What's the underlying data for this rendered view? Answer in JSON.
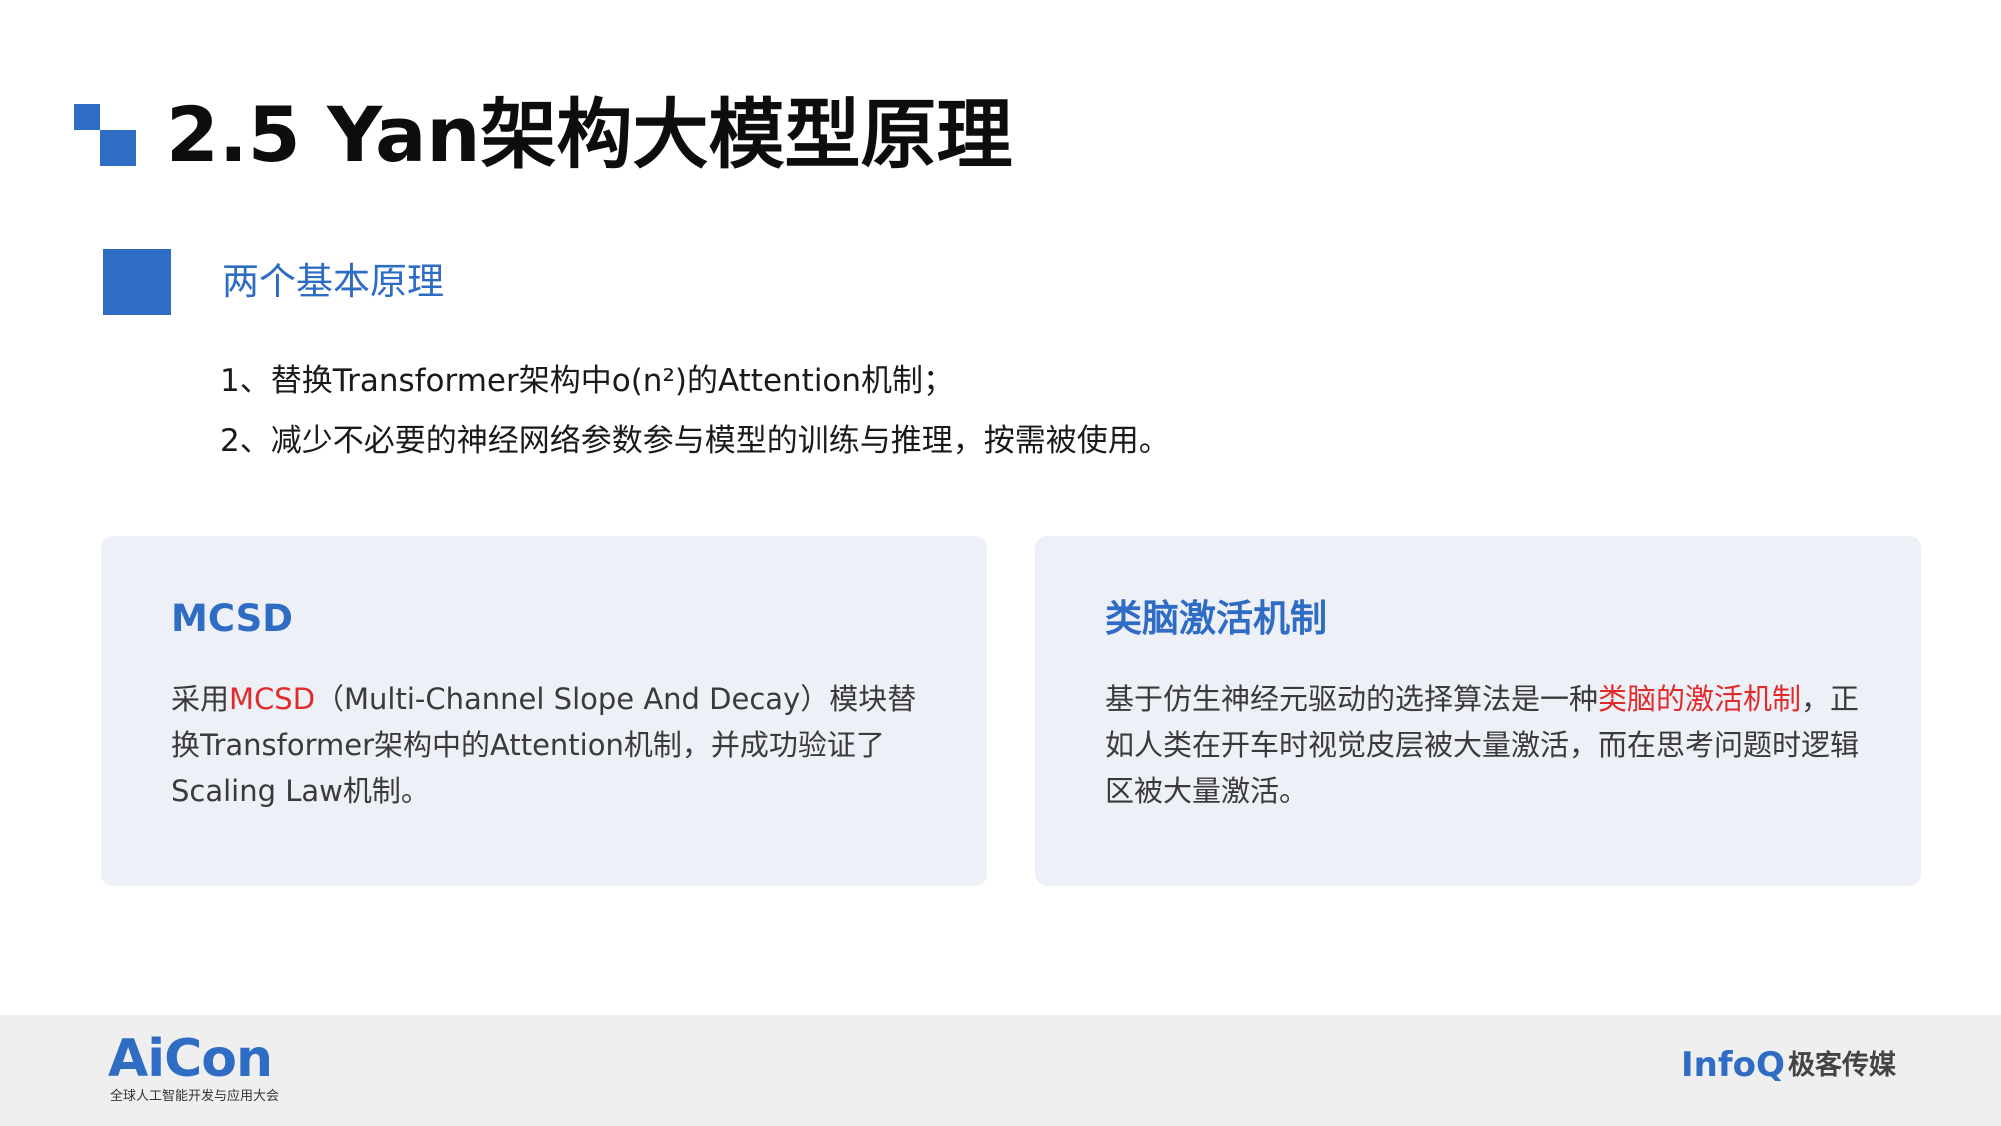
{
  "header": {
    "title": "2.5 Yan架构大模型原理"
  },
  "section": {
    "title": "两个基本原理",
    "principles": [
      "1、替换Transformer架构中o(n²)的Attention机制；",
      "2、减少不必要的神经网络参数参与模型的训练与推理，按需被使用。"
    ]
  },
  "cards": [
    {
      "title": "MCSD",
      "body_before": "采用",
      "body_highlight": "MCSD",
      "body_after": "（Multi-Channel Slope And Decay）模块替换Transformer架构中的Attention机制，并成功验证了Scaling Law机制。"
    },
    {
      "title": "类脑激活机制",
      "body_before": "基于仿生神经元驱动的选择算法是一种",
      "body_highlight": "类脑的激活机制",
      "body_after": "，正如人类在开车时视觉皮层被大量激活，而在思考问题时逻辑区被大量激活。"
    }
  ],
  "footer": {
    "left_logo": "AiCon",
    "left_subtitle": "全球人工智能开发与应用大会",
    "right_logo_infoq": "InfoQ",
    "right_logo_geek": "极客传媒"
  },
  "colors": {
    "accent": "#2f6cc4",
    "highlight": "#e02b2b",
    "card_bg": "#eef0f8",
    "footer_bg": "#efefef"
  }
}
